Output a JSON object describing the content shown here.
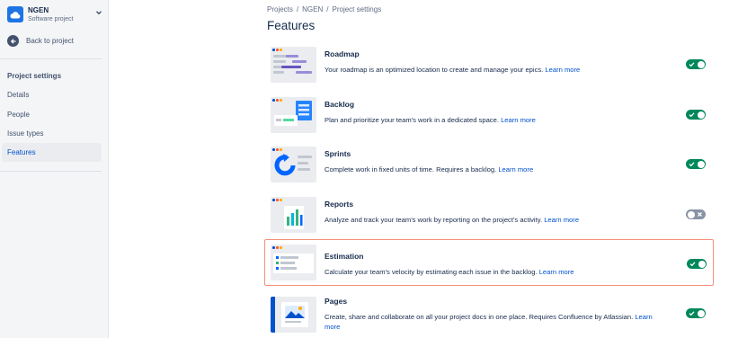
{
  "project": {
    "name": "NGEN",
    "type": "Software project"
  },
  "sidebar": {
    "back_label": "Back to project",
    "section_title": "Project settings",
    "items": [
      {
        "label": "Details",
        "active": false
      },
      {
        "label": "People",
        "active": false
      },
      {
        "label": "Issue types",
        "active": false
      },
      {
        "label": "Features",
        "active": true
      }
    ]
  },
  "breadcrumb": [
    "Projects",
    "NGEN",
    "Project settings"
  ],
  "breadcrumb_sep": "/",
  "page_title": "Features",
  "learn_more": "Learn more",
  "colors": {
    "accent": "#0052CC",
    "toggle_on": "#00875A",
    "toggle_off": "#8993A4",
    "highlight_border": "#F4917E"
  },
  "features": [
    {
      "title": "Roadmap",
      "description": "Your roadmap is an optimized location to create and manage your epics.",
      "enabled": true
    },
    {
      "title": "Backlog",
      "description": "Plan and prioritize your team's work in a dedicated space.",
      "enabled": true
    },
    {
      "title": "Sprints",
      "description": "Complete work in fixed units of time. Requires a backlog.",
      "enabled": true
    },
    {
      "title": "Reports",
      "description": "Analyze and track your team's work by reporting on the project's activity.",
      "enabled": false
    },
    {
      "title": "Estimation",
      "description": "Calculate your team's velocity by estimating each issue in the backlog.",
      "enabled": true
    },
    {
      "title": "Pages",
      "description": "Create, share and collaborate on all your project docs in one place. Requires Confluence by Atlassian.",
      "enabled": true
    }
  ]
}
